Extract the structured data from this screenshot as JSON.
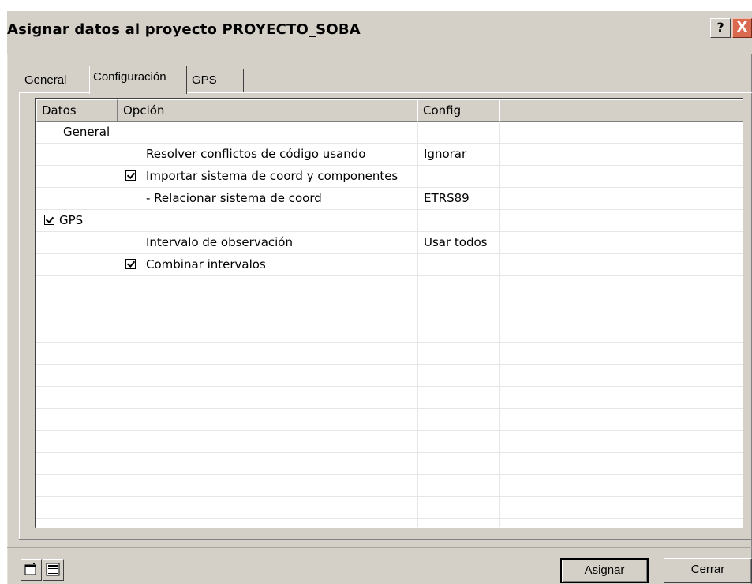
{
  "window": {
    "title": "Asignar datos al proyecto PROYECTO_SOBA",
    "help_label": "?",
    "close_label": "X"
  },
  "tabs": [
    {
      "label": "General",
      "active": false
    },
    {
      "label": "Configuración",
      "active": true
    },
    {
      "label": "GPS",
      "active": false
    }
  ],
  "grid": {
    "columns": [
      "Datos",
      "Opción",
      "Config",
      ""
    ],
    "rows": [
      {
        "datos": "General",
        "datos_checked": false,
        "opcion": "",
        "opcion_checked": false,
        "config": ""
      },
      {
        "datos": "",
        "datos_checked": false,
        "opcion": "Resolver conflictos de código usando",
        "opcion_checked": false,
        "config": "Ignorar"
      },
      {
        "datos": "",
        "datos_checked": false,
        "opcion": "Importar sistema de coord y componentes",
        "opcion_checked": true,
        "config": ""
      },
      {
        "datos": "",
        "datos_checked": false,
        "opcion": "- Relacionar sistema de coord",
        "opcion_checked": false,
        "config": "ETRS89"
      },
      {
        "datos": "GPS",
        "datos_checked": true,
        "opcion": "",
        "opcion_checked": false,
        "config": ""
      },
      {
        "datos": "",
        "datos_checked": false,
        "opcion": "Intervalo de observación",
        "opcion_checked": false,
        "config": "Usar todos"
      },
      {
        "datos": "",
        "datos_checked": false,
        "opcion": "Combinar intervalos",
        "opcion_checked": true,
        "config": ""
      }
    ]
  },
  "footer": {
    "icon_buttons": [
      "window-icon",
      "list-icon"
    ],
    "assign_label": "Asignar",
    "close_label": "Cerrar"
  }
}
